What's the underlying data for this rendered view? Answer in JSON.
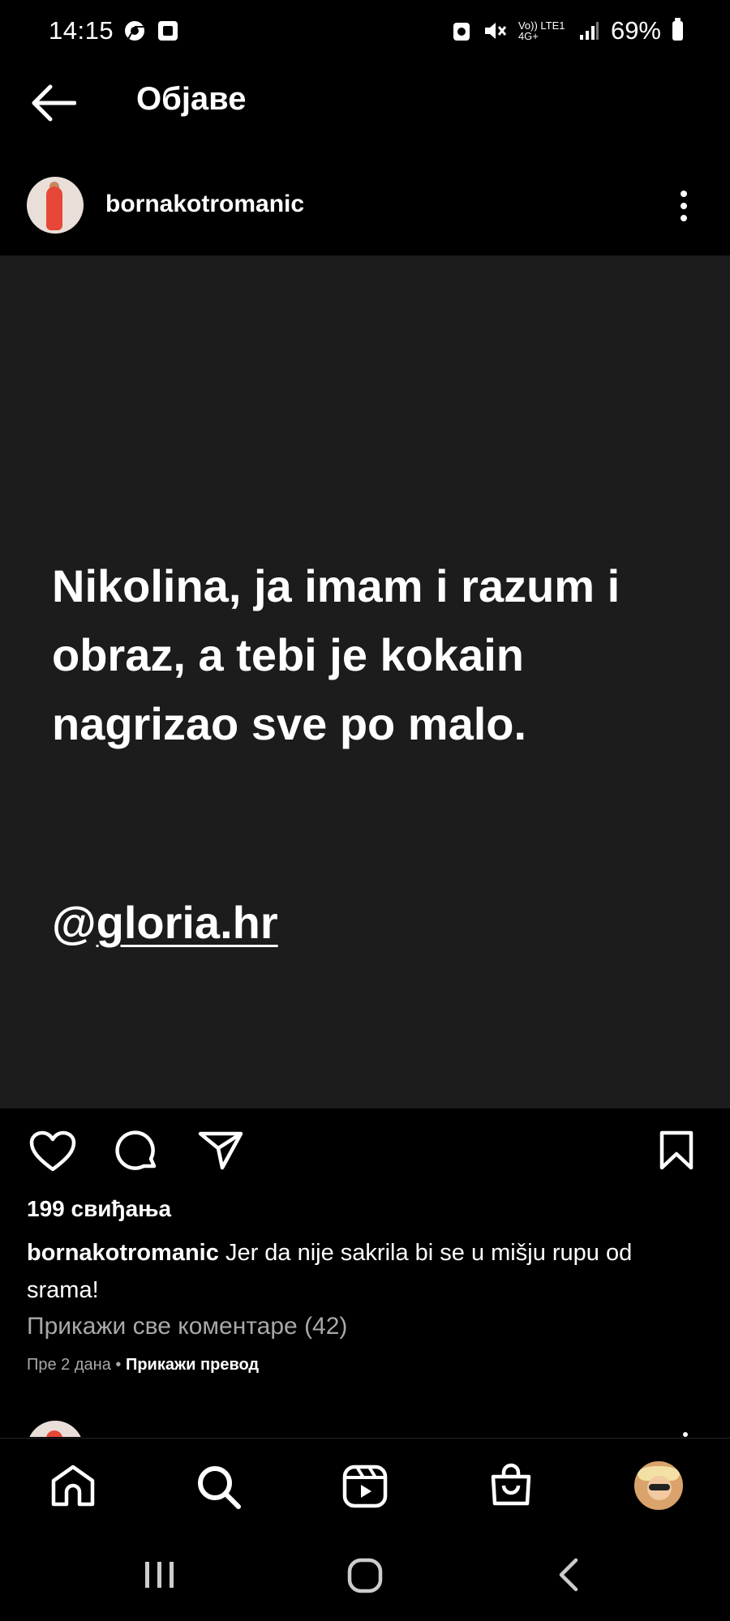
{
  "status_bar": {
    "time": "14:15",
    "network_text": "Vo)) LTE1 4G+",
    "battery": "69%"
  },
  "header": {
    "title": "Објаве",
    "back_icon": "arrow-left-icon"
  },
  "post": {
    "username": "bornakotromanic",
    "image_text": {
      "quote": "Nikolina, ja imam i razum i obraz, a tebi je kokain nagrizao sve po malo.",
      "mention_prefix": "@",
      "mention_link": "gloria.hr"
    },
    "likes": "199 свиђања",
    "caption_user": "bornakotromanic",
    "caption_text": "Jer da nije sakrila bi se u mišju rupu od srama!",
    "view_comments": "Прикажи све коментаре (42)",
    "time_ago": "Пре 2 дана",
    "separator": "•",
    "see_translation": "Прикажи превод"
  },
  "bottom_nav": {
    "items": [
      "home-icon",
      "search-icon",
      "reels-icon",
      "shop-icon",
      "profile-avatar"
    ]
  },
  "system_nav": {
    "items": [
      "recents-icon",
      "home-circle-icon",
      "back-chevron-icon"
    ]
  },
  "colors": {
    "background": "#000000",
    "post_background": "#1c1c1c",
    "secondary_text": "#a8a8a8"
  }
}
